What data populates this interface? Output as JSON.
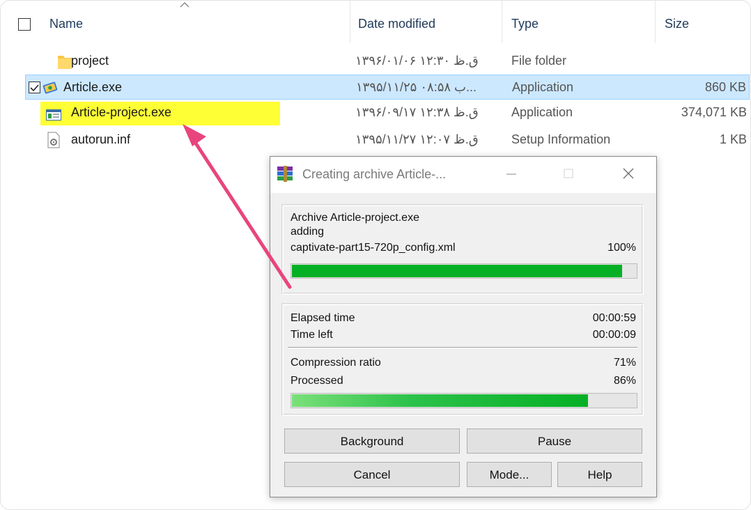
{
  "explorer": {
    "columns": {
      "name": "Name",
      "date_modified": "Date modified",
      "type": "Type",
      "size": "Size"
    },
    "files": [
      {
        "name": "project",
        "date": "۱۳۹۶/۰۱/۰۶ ق.ظ ۱۲:۳۰",
        "type": "File folder",
        "size": "",
        "icon": "folder-icon"
      },
      {
        "name": "Article.exe",
        "date": "۱۳۹۵/۱۱/۲۵ ب ۰۸:۵۸...",
        "type": "Application",
        "size": "860 KB",
        "icon": "application-icon",
        "selected": true
      },
      {
        "name": "Article-project.exe",
        "date": "۱۳۹۶/۰۹/۱۷ ق.ظ ۱۲:۳۸",
        "type": "Application",
        "size": "374,071 KB",
        "icon": "sfx-exe-icon",
        "highlighted": true
      },
      {
        "name": "autorun.inf",
        "date": "۱۳۹۵/۱۱/۲۷ ق.ظ ۱۲:۰۷",
        "type": "Setup Information",
        "size": "1 KB",
        "icon": "settings-file-icon"
      }
    ]
  },
  "dialog": {
    "title": "Creating archive Article-...",
    "archive_line": "Archive Article-project.exe",
    "action": "adding",
    "current_file": "captivate-part15-720p_config.xml",
    "file_percent": "100%",
    "file_progress": 0.96,
    "elapsed_label": "Elapsed time",
    "elapsed_value": "00:00:59",
    "left_label": "Time left",
    "left_value": "00:00:09",
    "ratio_label": "Compression ratio",
    "ratio_value": "71%",
    "processed_label": "Processed",
    "processed_value": "86%",
    "processed_progress": 0.86,
    "buttons": {
      "background": "Background",
      "pause": "Pause",
      "cancel": "Cancel",
      "mode": "Mode...",
      "help": "Help"
    }
  },
  "annotation": {
    "arrow_color": "#e8457e",
    "highlight_color": "#ffff36"
  }
}
